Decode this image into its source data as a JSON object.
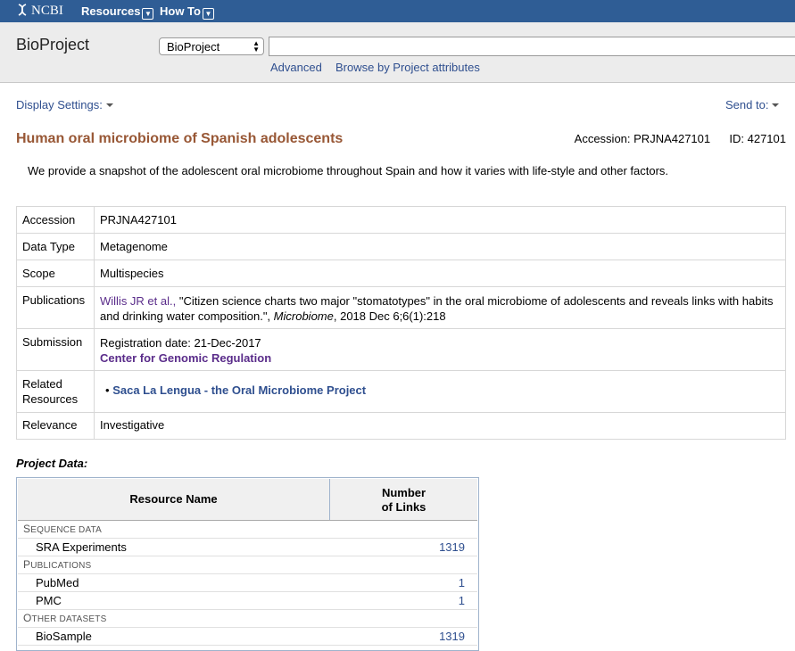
{
  "topbar": {
    "brand": "NCBI",
    "menu": [
      "Resources",
      "How To"
    ]
  },
  "search": {
    "db_title": "BioProject",
    "db_selected": "BioProject",
    "query": "",
    "links": [
      "Advanced",
      "Browse by Project attributes"
    ]
  },
  "toolbar": {
    "display_settings": "Display Settings:",
    "send_to": "Send to:"
  },
  "project": {
    "title": "Human oral microbiome of Spanish adolescents",
    "accession_line": "Accession: PRJNA427101",
    "id_line": "ID: 427101",
    "description": "We provide a snapshot of the adolescent oral microbiome throughout Spain and how it varies with life-style and other factors."
  },
  "info": {
    "accession_label": "Accession",
    "accession": "PRJNA427101",
    "datatype_label": "Data Type",
    "datatype": "Metagenome",
    "scope_label": "Scope",
    "scope": "Multispecies",
    "pub_label": "Publications",
    "pub_authors": "Willis JR et al.,",
    "pub_title": "\"Citizen science charts two major \"stomatotypes\" in the oral microbiome of adolescents and reveals links with habits and drinking water composition.\",",
    "pub_journal": "Microbiome",
    "pub_cite": ", 2018 Dec 6;6(1):218",
    "submission_label": "Submission",
    "submission_date": "Registration date: 21-Dec-2017",
    "submission_center": "Center for Genomic Regulation",
    "related_label_1": "Related",
    "related_label_2": "Resources",
    "related_link": "Saca La Lengua - the Oral Microbiome Project",
    "relevance_label": "Relevance",
    "relevance": "Investigative"
  },
  "project_data": {
    "label": "Project Data:",
    "col_name": "Resource Name",
    "col_links_1": "Number",
    "col_links_2": "of Links",
    "cat_sequence": "Sequence data",
    "sra": "SRA Experiments",
    "sra_count": "1319",
    "cat_pub": "Publications",
    "pubmed": "PubMed",
    "pubmed_count": "1",
    "pmc": "PMC",
    "pmc_count": "1",
    "cat_other": "Other datasets",
    "biosample": "BioSample",
    "biosample_count": "1319"
  }
}
